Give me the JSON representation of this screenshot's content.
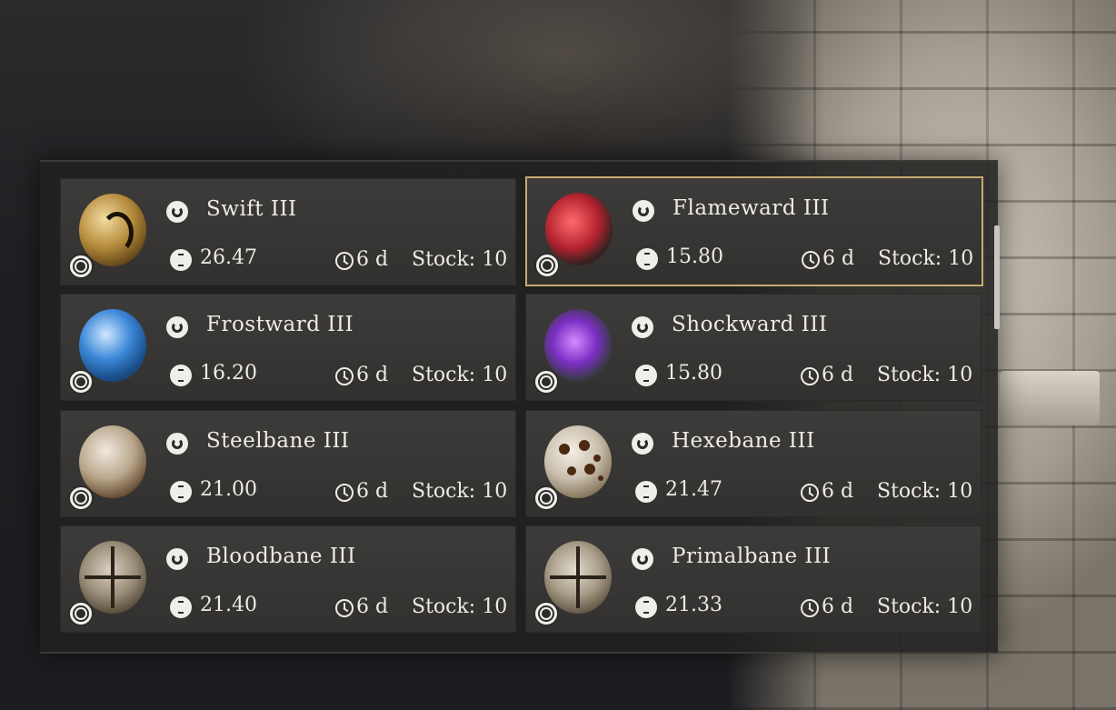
{
  "items": [
    {
      "name": "Swift III",
      "price": "26.47",
      "duration": "6 d",
      "stock": "Stock: 10"
    },
    {
      "name": "Flameward III",
      "price": "15.80",
      "duration": "6 d",
      "stock": "Stock: 10"
    },
    {
      "name": "Frostward III",
      "price": "16.20",
      "duration": "6 d",
      "stock": "Stock: 10"
    },
    {
      "name": "Shockward III",
      "price": "15.80",
      "duration": "6 d",
      "stock": "Stock: 10"
    },
    {
      "name": "Steelbane III",
      "price": "21.00",
      "duration": "6 d",
      "stock": "Stock: 10"
    },
    {
      "name": "Hexebane III",
      "price": "21.47",
      "duration": "6 d",
      "stock": "Stock: 10"
    },
    {
      "name": "Bloodbane III",
      "price": "21.40",
      "duration": "6 d",
      "stock": "Stock: 10"
    },
    {
      "name": "Primalbane III",
      "price": "21.33",
      "duration": "6 d",
      "stock": "Stock: 10"
    }
  ],
  "selected_index": 1,
  "colors": {
    "selected_border": "#c9a96e",
    "card_bg": "#363533",
    "text": "#eeebe4"
  }
}
